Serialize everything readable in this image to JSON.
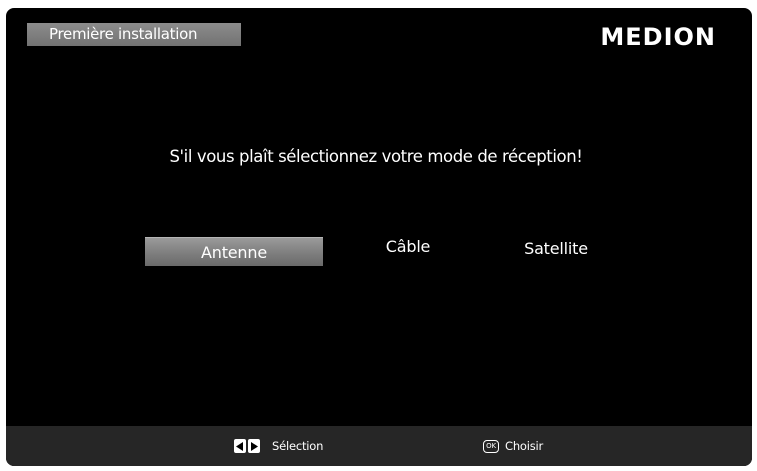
{
  "header": {
    "title": "Première installation",
    "brand": "MEDION"
  },
  "main": {
    "prompt": "S'il vous plaît sélectionnez votre mode de réception!",
    "options": [
      {
        "label": "Antenne",
        "selected": true
      },
      {
        "label": "Câble",
        "selected": false
      },
      {
        "label": "Satellite",
        "selected": false
      }
    ]
  },
  "footer": {
    "select_label": "Sélection",
    "ok_key": "OK",
    "confirm_label": "Choisir",
    "icons": [
      "arrow-left-icon",
      "arrow-right-icon",
      "ok-button-icon"
    ]
  },
  "colors": {
    "background": "#000000",
    "highlight": "#8c8c8c",
    "footer": "#262626",
    "text": "#ffffff"
  }
}
